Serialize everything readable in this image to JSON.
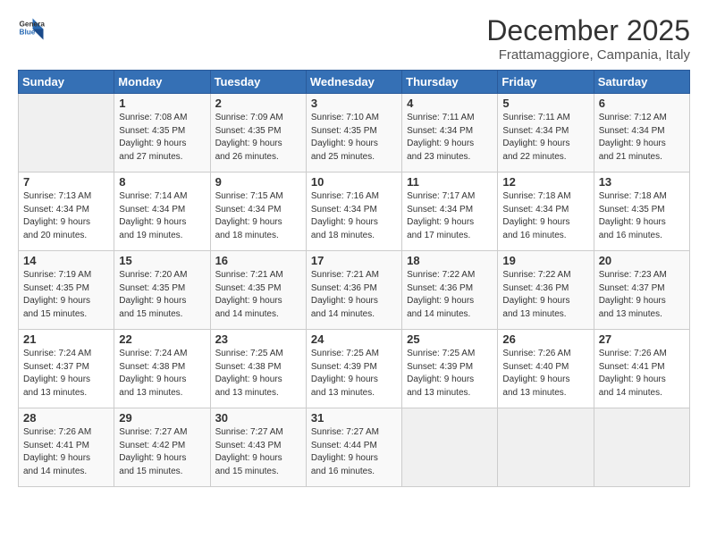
{
  "logo": {
    "general": "General",
    "blue": "Blue"
  },
  "title": "December 2025",
  "location": "Frattamaggiore, Campania, Italy",
  "days_of_week": [
    "Sunday",
    "Monday",
    "Tuesday",
    "Wednesday",
    "Thursday",
    "Friday",
    "Saturday"
  ],
  "weeks": [
    [
      {
        "day": "",
        "info": ""
      },
      {
        "day": "1",
        "info": "Sunrise: 7:08 AM\nSunset: 4:35 PM\nDaylight: 9 hours\nand 27 minutes."
      },
      {
        "day": "2",
        "info": "Sunrise: 7:09 AM\nSunset: 4:35 PM\nDaylight: 9 hours\nand 26 minutes."
      },
      {
        "day": "3",
        "info": "Sunrise: 7:10 AM\nSunset: 4:35 PM\nDaylight: 9 hours\nand 25 minutes."
      },
      {
        "day": "4",
        "info": "Sunrise: 7:11 AM\nSunset: 4:34 PM\nDaylight: 9 hours\nand 23 minutes."
      },
      {
        "day": "5",
        "info": "Sunrise: 7:11 AM\nSunset: 4:34 PM\nDaylight: 9 hours\nand 22 minutes."
      },
      {
        "day": "6",
        "info": "Sunrise: 7:12 AM\nSunset: 4:34 PM\nDaylight: 9 hours\nand 21 minutes."
      }
    ],
    [
      {
        "day": "7",
        "info": "Sunrise: 7:13 AM\nSunset: 4:34 PM\nDaylight: 9 hours\nand 20 minutes."
      },
      {
        "day": "8",
        "info": "Sunrise: 7:14 AM\nSunset: 4:34 PM\nDaylight: 9 hours\nand 19 minutes."
      },
      {
        "day": "9",
        "info": "Sunrise: 7:15 AM\nSunset: 4:34 PM\nDaylight: 9 hours\nand 18 minutes."
      },
      {
        "day": "10",
        "info": "Sunrise: 7:16 AM\nSunset: 4:34 PM\nDaylight: 9 hours\nand 18 minutes."
      },
      {
        "day": "11",
        "info": "Sunrise: 7:17 AM\nSunset: 4:34 PM\nDaylight: 9 hours\nand 17 minutes."
      },
      {
        "day": "12",
        "info": "Sunrise: 7:18 AM\nSunset: 4:34 PM\nDaylight: 9 hours\nand 16 minutes."
      },
      {
        "day": "13",
        "info": "Sunrise: 7:18 AM\nSunset: 4:35 PM\nDaylight: 9 hours\nand 16 minutes."
      }
    ],
    [
      {
        "day": "14",
        "info": "Sunrise: 7:19 AM\nSunset: 4:35 PM\nDaylight: 9 hours\nand 15 minutes."
      },
      {
        "day": "15",
        "info": "Sunrise: 7:20 AM\nSunset: 4:35 PM\nDaylight: 9 hours\nand 15 minutes."
      },
      {
        "day": "16",
        "info": "Sunrise: 7:21 AM\nSunset: 4:35 PM\nDaylight: 9 hours\nand 14 minutes."
      },
      {
        "day": "17",
        "info": "Sunrise: 7:21 AM\nSunset: 4:36 PM\nDaylight: 9 hours\nand 14 minutes."
      },
      {
        "day": "18",
        "info": "Sunrise: 7:22 AM\nSunset: 4:36 PM\nDaylight: 9 hours\nand 14 minutes."
      },
      {
        "day": "19",
        "info": "Sunrise: 7:22 AM\nSunset: 4:36 PM\nDaylight: 9 hours\nand 13 minutes."
      },
      {
        "day": "20",
        "info": "Sunrise: 7:23 AM\nSunset: 4:37 PM\nDaylight: 9 hours\nand 13 minutes."
      }
    ],
    [
      {
        "day": "21",
        "info": "Sunrise: 7:24 AM\nSunset: 4:37 PM\nDaylight: 9 hours\nand 13 minutes."
      },
      {
        "day": "22",
        "info": "Sunrise: 7:24 AM\nSunset: 4:38 PM\nDaylight: 9 hours\nand 13 minutes."
      },
      {
        "day": "23",
        "info": "Sunrise: 7:25 AM\nSunset: 4:38 PM\nDaylight: 9 hours\nand 13 minutes."
      },
      {
        "day": "24",
        "info": "Sunrise: 7:25 AM\nSunset: 4:39 PM\nDaylight: 9 hours\nand 13 minutes."
      },
      {
        "day": "25",
        "info": "Sunrise: 7:25 AM\nSunset: 4:39 PM\nDaylight: 9 hours\nand 13 minutes."
      },
      {
        "day": "26",
        "info": "Sunrise: 7:26 AM\nSunset: 4:40 PM\nDaylight: 9 hours\nand 13 minutes."
      },
      {
        "day": "27",
        "info": "Sunrise: 7:26 AM\nSunset: 4:41 PM\nDaylight: 9 hours\nand 14 minutes."
      }
    ],
    [
      {
        "day": "28",
        "info": "Sunrise: 7:26 AM\nSunset: 4:41 PM\nDaylight: 9 hours\nand 14 minutes."
      },
      {
        "day": "29",
        "info": "Sunrise: 7:27 AM\nSunset: 4:42 PM\nDaylight: 9 hours\nand 15 minutes."
      },
      {
        "day": "30",
        "info": "Sunrise: 7:27 AM\nSunset: 4:43 PM\nDaylight: 9 hours\nand 15 minutes."
      },
      {
        "day": "31",
        "info": "Sunrise: 7:27 AM\nSunset: 4:44 PM\nDaylight: 9 hours\nand 16 minutes."
      },
      {
        "day": "",
        "info": ""
      },
      {
        "day": "",
        "info": ""
      },
      {
        "day": "",
        "info": ""
      }
    ]
  ]
}
